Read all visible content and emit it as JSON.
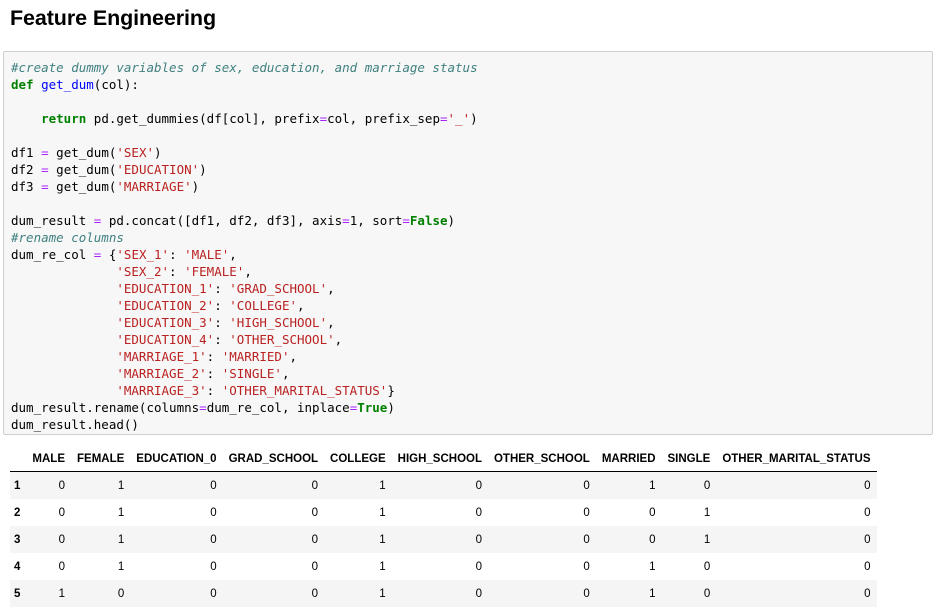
{
  "page": {
    "heading": "Feature Engineering"
  },
  "code_cell": {
    "lines": [
      [
        {
          "t": "comment",
          "v": "#create dummy variables of sex, education, and marriage status"
        }
      ],
      [
        {
          "t": "keyword",
          "v": "def"
        },
        {
          "t": "plain",
          "v": " "
        },
        {
          "t": "func",
          "v": "get_dum"
        },
        {
          "t": "plain",
          "v": "(col):"
        }
      ],
      [],
      [
        {
          "t": "plain",
          "v": "    "
        },
        {
          "t": "keyword",
          "v": "return"
        },
        {
          "t": "plain",
          "v": " pd.get_dummies(df[col], prefix"
        },
        {
          "t": "op",
          "v": "="
        },
        {
          "t": "plain",
          "v": "col, prefix_sep"
        },
        {
          "t": "op",
          "v": "="
        },
        {
          "t": "str",
          "v": "'_'"
        },
        {
          "t": "plain",
          "v": ")"
        }
      ],
      [],
      [
        {
          "t": "plain",
          "v": "df1 "
        },
        {
          "t": "op",
          "v": "="
        },
        {
          "t": "plain",
          "v": " get_dum("
        },
        {
          "t": "str",
          "v": "'SEX'"
        },
        {
          "t": "plain",
          "v": ")"
        }
      ],
      [
        {
          "t": "plain",
          "v": "df2 "
        },
        {
          "t": "op",
          "v": "="
        },
        {
          "t": "plain",
          "v": " get_dum("
        },
        {
          "t": "str",
          "v": "'EDUCATION'"
        },
        {
          "t": "plain",
          "v": ")"
        }
      ],
      [
        {
          "t": "plain",
          "v": "df3 "
        },
        {
          "t": "op",
          "v": "="
        },
        {
          "t": "plain",
          "v": " get_dum("
        },
        {
          "t": "str",
          "v": "'MARRIAGE'"
        },
        {
          "t": "plain",
          "v": ")"
        }
      ],
      [],
      [
        {
          "t": "plain",
          "v": "dum_result "
        },
        {
          "t": "op",
          "v": "="
        },
        {
          "t": "plain",
          "v": " pd.concat([df1, df2, df3], axis"
        },
        {
          "t": "op",
          "v": "="
        },
        {
          "t": "plain",
          "v": "1, sort"
        },
        {
          "t": "op",
          "v": "="
        },
        {
          "t": "keyword",
          "v": "False"
        },
        {
          "t": "plain",
          "v": ")"
        }
      ],
      [
        {
          "t": "comment",
          "v": "#rename columns"
        }
      ],
      [
        {
          "t": "plain",
          "v": "dum_re_col "
        },
        {
          "t": "op",
          "v": "="
        },
        {
          "t": "plain",
          "v": " {"
        },
        {
          "t": "str",
          "v": "'SEX_1'"
        },
        {
          "t": "plain",
          "v": ": "
        },
        {
          "t": "str",
          "v": "'MALE'"
        },
        {
          "t": "plain",
          "v": ","
        }
      ],
      [
        {
          "t": "plain",
          "v": "              "
        },
        {
          "t": "str",
          "v": "'SEX_2'"
        },
        {
          "t": "plain",
          "v": ": "
        },
        {
          "t": "str",
          "v": "'FEMALE'"
        },
        {
          "t": "plain",
          "v": ","
        }
      ],
      [
        {
          "t": "plain",
          "v": "              "
        },
        {
          "t": "str",
          "v": "'EDUCATION_1'"
        },
        {
          "t": "plain",
          "v": ": "
        },
        {
          "t": "str",
          "v": "'GRAD_SCHOOL'"
        },
        {
          "t": "plain",
          "v": ","
        }
      ],
      [
        {
          "t": "plain",
          "v": "              "
        },
        {
          "t": "str",
          "v": "'EDUCATION_2'"
        },
        {
          "t": "plain",
          "v": ": "
        },
        {
          "t": "str",
          "v": "'COLLEGE'"
        },
        {
          "t": "plain",
          "v": ","
        }
      ],
      [
        {
          "t": "plain",
          "v": "              "
        },
        {
          "t": "str",
          "v": "'EDUCATION_3'"
        },
        {
          "t": "plain",
          "v": ": "
        },
        {
          "t": "str",
          "v": "'HIGH_SCHOOL'"
        },
        {
          "t": "plain",
          "v": ","
        }
      ],
      [
        {
          "t": "plain",
          "v": "              "
        },
        {
          "t": "str",
          "v": "'EDUCATION_4'"
        },
        {
          "t": "plain",
          "v": ": "
        },
        {
          "t": "str",
          "v": "'OTHER_SCHOOL'"
        },
        {
          "t": "plain",
          "v": ","
        }
      ],
      [
        {
          "t": "plain",
          "v": "              "
        },
        {
          "t": "str",
          "v": "'MARRIAGE_1'"
        },
        {
          "t": "plain",
          "v": ": "
        },
        {
          "t": "str",
          "v": "'MARRIED'"
        },
        {
          "t": "plain",
          "v": ","
        }
      ],
      [
        {
          "t": "plain",
          "v": "              "
        },
        {
          "t": "str",
          "v": "'MARRIAGE_2'"
        },
        {
          "t": "plain",
          "v": ": "
        },
        {
          "t": "str",
          "v": "'SINGLE'"
        },
        {
          "t": "plain",
          "v": ","
        }
      ],
      [
        {
          "t": "plain",
          "v": "              "
        },
        {
          "t": "str",
          "v": "'MARRIAGE_3'"
        },
        {
          "t": "plain",
          "v": ": "
        },
        {
          "t": "str",
          "v": "'OTHER_MARITAL_STATUS'"
        },
        {
          "t": "plain",
          "v": "}"
        }
      ],
      [
        {
          "t": "plain",
          "v": "dum_result.rename(columns"
        },
        {
          "t": "op",
          "v": "="
        },
        {
          "t": "plain",
          "v": "dum_re_col, inplace"
        },
        {
          "t": "op",
          "v": "="
        },
        {
          "t": "keyword",
          "v": "True"
        },
        {
          "t": "plain",
          "v": ")"
        }
      ],
      [
        {
          "t": "plain",
          "v": "dum_result.head()"
        }
      ]
    ]
  },
  "output_table": {
    "columns": [
      "",
      "MALE",
      "FEMALE",
      "EDUCATION_0",
      "GRAD_SCHOOL",
      "COLLEGE",
      "HIGH_SCHOOL",
      "OTHER_SCHOOL",
      "MARRIED",
      "SINGLE",
      "OTHER_MARITAL_STATUS"
    ],
    "rows": [
      {
        "index": "1",
        "values": [
          "0",
          "1",
          "0",
          "0",
          "1",
          "0",
          "0",
          "1",
          "0",
          "0"
        ]
      },
      {
        "index": "2",
        "values": [
          "0",
          "1",
          "0",
          "0",
          "1",
          "0",
          "0",
          "0",
          "1",
          "0"
        ]
      },
      {
        "index": "3",
        "values": [
          "0",
          "1",
          "0",
          "0",
          "1",
          "0",
          "0",
          "0",
          "1",
          "0"
        ]
      },
      {
        "index": "4",
        "values": [
          "0",
          "1",
          "0",
          "0",
          "1",
          "0",
          "0",
          "1",
          "0",
          "0"
        ]
      },
      {
        "index": "5",
        "values": [
          "1",
          "0",
          "0",
          "0",
          "1",
          "0",
          "0",
          "1",
          "0",
          "0"
        ]
      }
    ]
  },
  "colors": {
    "comment": "#408080",
    "keyword": "#008000",
    "function": "#0000ff",
    "string": "#ba2121",
    "operator": "#aa22ff",
    "cell_background": "#f7f7f7",
    "cell_border": "#cfcfcf",
    "row_stripe": "#f5f5f5"
  }
}
